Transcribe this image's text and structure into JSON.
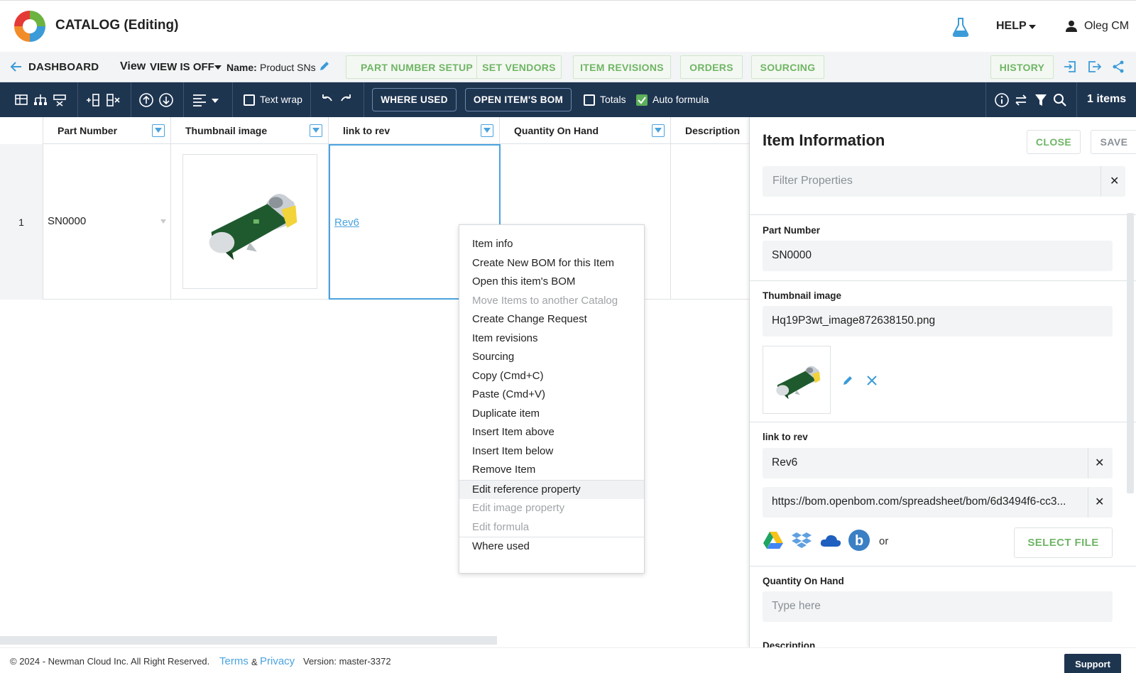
{
  "header": {
    "app_title": "CATALOG (Editing)",
    "help_label": "HELP",
    "user_name": "Oleg CM"
  },
  "nav": {
    "back_label": "DASHBOARD",
    "view_label": "View",
    "view_value": "VIEW IS OFF",
    "name_label": "Name:",
    "name_value": "Product SNs",
    "buttons": [
      "PART NUMBER SETUP",
      "SET VENDORS",
      "ITEM REVISIONS",
      "ORDERS",
      "SOURCING"
    ],
    "history_label": "HISTORY"
  },
  "toolbar": {
    "text_wrap_label": "Text wrap",
    "where_used_label": "WHERE USED",
    "open_bom_label": "OPEN ITEM'S BOM",
    "totals_label": "Totals",
    "auto_formula_label": "Auto formula",
    "items_count": "1 items"
  },
  "grid": {
    "columns": [
      "Part Number",
      "Thumbnail image",
      "link to rev",
      "Quantity On Hand",
      "Description"
    ],
    "rows": [
      {
        "num": "1",
        "part_number": "SN0000",
        "link_to_rev": "Rev6"
      }
    ]
  },
  "context_menu": {
    "items": [
      {
        "label": "Item info",
        "disabled": false
      },
      {
        "label": "Create New BOM for this Item",
        "disabled": false
      },
      {
        "label": "Open this item's BOM",
        "disabled": false
      },
      {
        "label": "Move Items to another Catalog",
        "disabled": true
      },
      {
        "label": "Create Change Request",
        "disabled": false
      },
      {
        "label": "Item revisions",
        "disabled": false
      },
      {
        "label": "Sourcing",
        "disabled": false
      },
      {
        "label": "Copy (Cmd+C)",
        "disabled": false
      },
      {
        "label": "Paste (Cmd+V)",
        "disabled": false
      },
      {
        "label": "Duplicate item",
        "disabled": false
      },
      {
        "label": "Insert Item above",
        "disabled": false
      },
      {
        "label": "Insert Item below",
        "disabled": false
      },
      {
        "label": "Remove Item",
        "disabled": false
      },
      {
        "label": "Edit reference property",
        "disabled": false
      },
      {
        "label": "Edit image property",
        "disabled": true
      },
      {
        "label": "Edit formula",
        "disabled": true
      },
      {
        "label": "Where used",
        "disabled": false
      }
    ]
  },
  "panel": {
    "title": "Item Information",
    "close_label": "CLOSE",
    "save_label": "SAVE",
    "filter_placeholder": "Filter Properties",
    "part_number_label": "Part Number",
    "part_number_value": "SN0000",
    "thumbnail_label": "Thumbnail image",
    "thumbnail_value": "Hq19P3wt_image872638150.png",
    "link_label": "link to rev",
    "link_value": "Rev6",
    "link_url": "https://bom.openbom.com/spreadsheet/bom/6d3494f6-cc3...",
    "or_label": "or",
    "select_file_label": "SELECT FILE",
    "qty_label": "Quantity On Hand",
    "qty_placeholder": "Type here",
    "description_label": "Description"
  },
  "footer": {
    "copyright": "© 2024 - Newman Cloud Inc. All Right Reserved.",
    "terms": "Terms",
    "amp": "&",
    "privacy": "Privacy",
    "version": "Version: master-3372",
    "support": "Support"
  },
  "colors": {
    "toolbar_bg": "#1e3550",
    "accent_green": "#6fb566",
    "link_blue": "#4aa3df"
  }
}
